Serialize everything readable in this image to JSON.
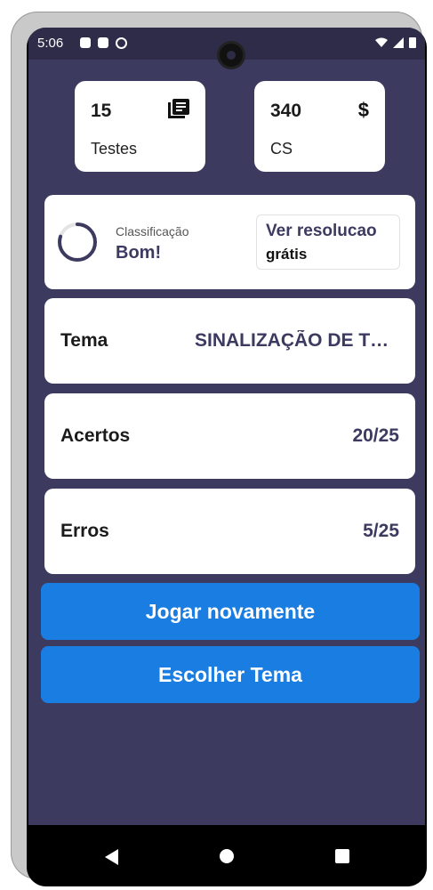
{
  "status_bar": {
    "time": "5:06",
    "icons": [
      "gallery-icon",
      "notification-icon",
      "sync-icon"
    ],
    "right_icons": [
      "wifi-icon",
      "signal-icon",
      "battery-icon"
    ]
  },
  "stats": {
    "tests": {
      "value": "15",
      "label": "Testes",
      "icon": "library-books-icon"
    },
    "coins": {
      "value": "340",
      "label": "CS",
      "icon": "$"
    }
  },
  "classification": {
    "title": "Classificação",
    "value": "Bom!",
    "progress": 0.8,
    "resolve_button": {
      "main": "Ver resolucao",
      "sub": "grátis"
    }
  },
  "rows": {
    "tema": {
      "label": "Tema",
      "value": "SINALIZAÇÃO DE TRÂNSITO"
    },
    "acertos": {
      "label": "Acertos",
      "value": "20/25"
    },
    "erros": {
      "label": "Erros",
      "value": "5/25"
    }
  },
  "buttons": {
    "play_again": "Jogar novamente",
    "choose_theme": "Escolher Tema"
  },
  "colors": {
    "background": "#3d3a60",
    "accent": "#1a7de2",
    "text_accent": "#3d3a60"
  }
}
